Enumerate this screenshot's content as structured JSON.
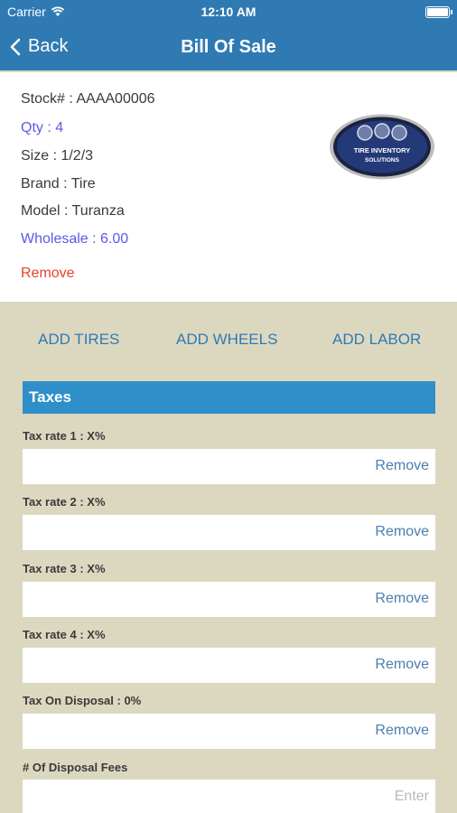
{
  "status_bar": {
    "carrier": "Carrier",
    "time": "12:10 AM"
  },
  "nav": {
    "back_label": "Back",
    "title": "Bill Of Sale"
  },
  "item": {
    "stock": "Stock# : AAAA00006",
    "qty": "Qty : 4",
    "size": "Size : 1/2/3",
    "brand": "Brand : Tire",
    "model": "Model : Turanza",
    "wholesale": "Wholesale : 6.00",
    "remove_label": "Remove",
    "logo_text_1": "TIRE INVENTORY",
    "logo_text_2": "SOLUTIONS"
  },
  "actions": {
    "add_tires": "ADD TIRES",
    "add_wheels": "ADD WHEELS",
    "add_labor": "ADD LABOR"
  },
  "taxes": {
    "header": "Taxes",
    "fields": [
      {
        "label": "Tax rate 1 : X%",
        "action": "Remove"
      },
      {
        "label": "Tax rate 2 : X%",
        "action": "Remove"
      },
      {
        "label": "Tax rate 3 : X%",
        "action": "Remove"
      },
      {
        "label": "Tax rate 4 : X%",
        "action": "Remove"
      },
      {
        "label": "Tax On Disposal : 0%",
        "action": "Remove"
      },
      {
        "label": "# Of Disposal Fees",
        "action": "Enter"
      }
    ]
  },
  "colors": {
    "nav_bg": "#2f7ab3",
    "page_bg": "#dcd8c0",
    "section_header": "#2f8fc9",
    "remove_red": "#e8402e",
    "qty_blue": "#5a5ae6"
  }
}
